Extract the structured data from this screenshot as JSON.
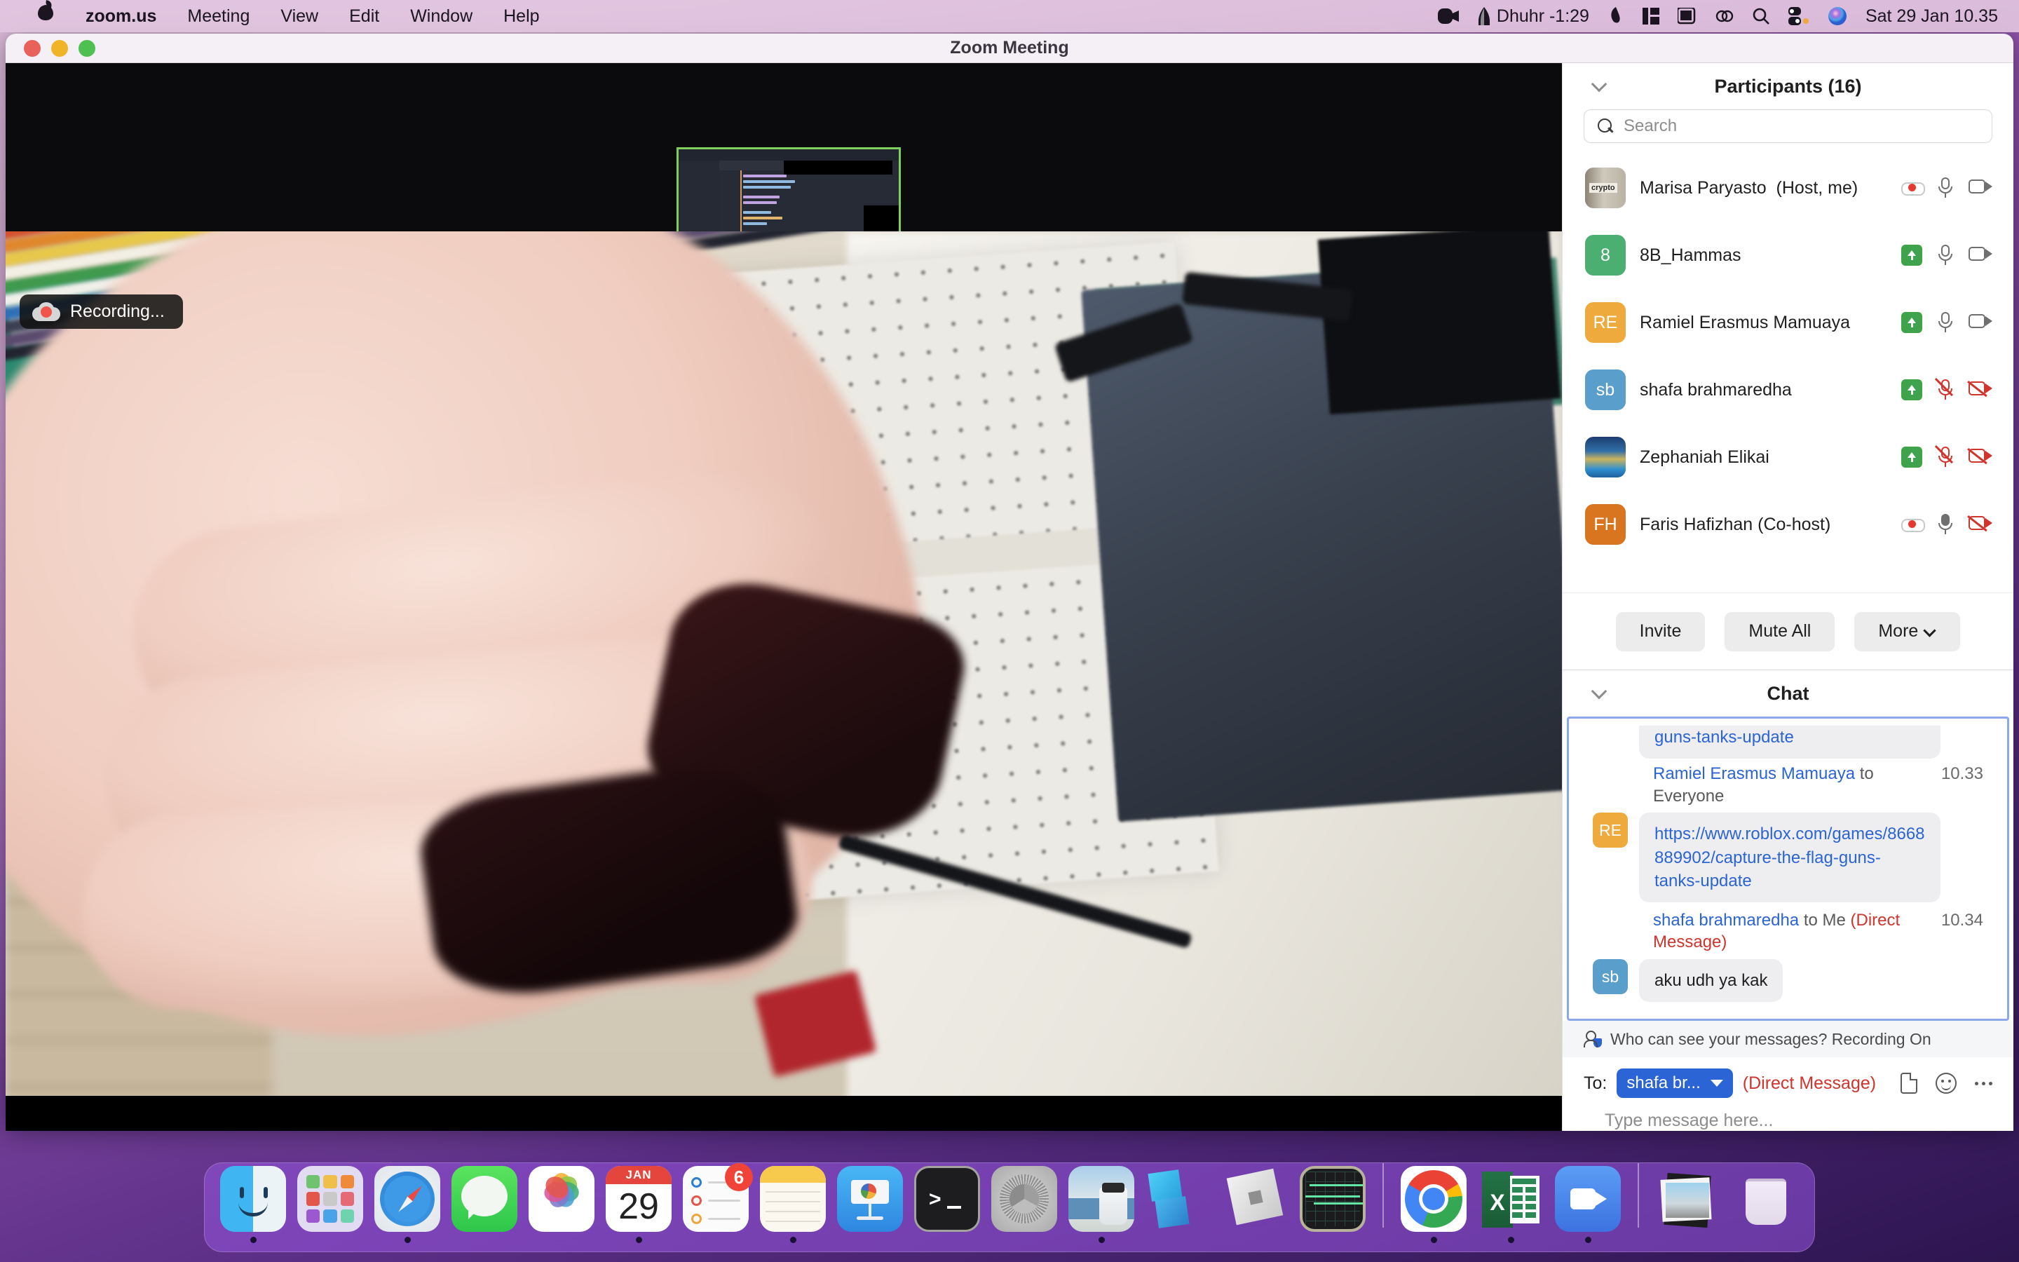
{
  "menubar": {
    "apple_icon": "apple-logo",
    "items": [
      {
        "label": "zoom.us",
        "bold": true
      },
      {
        "label": "Meeting",
        "bold": false
      },
      {
        "label": "View",
        "bold": false
      },
      {
        "label": "Edit",
        "bold": false
      },
      {
        "label": "Window",
        "bold": false
      },
      {
        "label": "Help",
        "bold": false
      }
    ],
    "status": {
      "video_icon": "video-camera-icon",
      "prayer_icon": "mosque-icon",
      "prayer_label": "Dhuhr -1:29",
      "shazam_icon": "shazam-icon",
      "stage_icon": "stage-manager-icon",
      "display_icon": "display-icon",
      "bluetooth_icon": "bluetooth-icon",
      "search_icon": "spotlight-search-icon",
      "controlcenter_icon": "control-center-icon",
      "siri_icon": "siri-icon",
      "clock": "Sat 29 Jan  10.35"
    }
  },
  "window": {
    "title": "Zoom Meeting",
    "traffic_lights": [
      "close",
      "minimize",
      "maximize"
    ]
  },
  "video": {
    "recording_badge": "Recording...",
    "recording_icon": "cloud-record-icon",
    "share_thumbnail_name": "screen-share-thumbnail"
  },
  "participants": {
    "title": "Participants (16)",
    "collapse_icon": "chevron-down-icon",
    "search": {
      "placeholder": "Search",
      "icon": "search-icon"
    },
    "rows": [
      {
        "name": "Marisa Paryasto",
        "role": "(Host, me)",
        "avatar_type": "photo-book",
        "avatar_initials": "",
        "avatar_color": "#8d8374",
        "raise_hand": false,
        "recording": true,
        "mic": "unmuted",
        "camera": "on"
      },
      {
        "name": "8B_Hammas",
        "role": "",
        "avatar_type": "initials",
        "avatar_initials": "8",
        "avatar_color": "#4caf72",
        "raise_hand": true,
        "recording": false,
        "mic": "unmuted",
        "camera": "on"
      },
      {
        "name": "Ramiel Erasmus Mamuaya",
        "role": "",
        "avatar_type": "initials",
        "avatar_initials": "RE",
        "avatar_color": "#eeaa3c",
        "raise_hand": true,
        "recording": false,
        "mic": "unmuted",
        "camera": "on"
      },
      {
        "name": "shafa brahmaredha",
        "role": "",
        "avatar_type": "initials",
        "avatar_initials": "sb",
        "avatar_color": "#5a9ecb",
        "raise_hand": true,
        "recording": false,
        "mic": "muted",
        "camera": "off"
      },
      {
        "name": "Zephaniah Elikai",
        "role": "",
        "avatar_type": "photo-lake",
        "avatar_initials": "",
        "avatar_color": "#2f6ea8",
        "raise_hand": true,
        "recording": false,
        "mic": "muted",
        "camera": "off"
      },
      {
        "name": "Faris Hafizhan (Co-host)",
        "role": "",
        "avatar_type": "initials",
        "avatar_initials": "FH",
        "avatar_color": "#d9741f",
        "raise_hand": false,
        "recording": true,
        "mic": "filled",
        "camera": "off"
      }
    ],
    "footer": {
      "invite": "Invite",
      "mute_all": "Mute All",
      "more": "More",
      "more_icon": "chevron-down-icon"
    }
  },
  "chat": {
    "title": "Chat",
    "collapse_icon": "chevron-down-icon",
    "messages": [
      {
        "continuation": true,
        "avatar_initials": "",
        "avatar_color": "#eeaa3c",
        "sender": "",
        "to": "",
        "time": "",
        "text": "guns-tanks-update",
        "is_link": true,
        "is_dm": false
      },
      {
        "continuation": false,
        "avatar_initials": "RE",
        "avatar_color": "#eeaa3c",
        "sender": "Ramiel Erasmus Mamuaya",
        "to": "to Everyone",
        "time": "10.33",
        "text": "https://www.roblox.com/games/8668889902/capture-the-flag-guns-tanks-update",
        "is_link": true,
        "is_dm": false
      },
      {
        "continuation": false,
        "avatar_initials": "sb",
        "avatar_color": "#5a9ecb",
        "sender": "shafa brahmaredha",
        "to": "to Me ",
        "dm_tag": "(Direct Message)",
        "time": "10.34",
        "text": "aku udh ya kak",
        "is_link": false,
        "is_dm": true
      }
    ],
    "notice": "Who can see your messages? Recording On",
    "notice_icon": "people-privacy-icon",
    "compose": {
      "to_label": "To:",
      "to_chip": "shafa br...",
      "to_chip_icon": "chevron-down-icon",
      "dm_tag": "(Direct Message)",
      "file_icon": "file-icon",
      "emoji_icon": "emoji-icon",
      "more_icon": "more-dots-icon",
      "placeholder": "Type message here..."
    }
  },
  "dock": {
    "items": [
      {
        "name": "finder",
        "label": "Finder",
        "running": true
      },
      {
        "name": "launchpad",
        "label": "Launchpad",
        "running": false
      },
      {
        "name": "safari",
        "label": "Safari",
        "running": true
      },
      {
        "name": "messages",
        "label": "Messages",
        "running": false
      },
      {
        "name": "photos",
        "label": "Photos",
        "running": false
      },
      {
        "name": "calendar",
        "label": "Calendar",
        "running": true,
        "month": "JAN",
        "day": "29"
      },
      {
        "name": "reminders",
        "label": "Reminders",
        "running": false,
        "badge": "6"
      },
      {
        "name": "notes",
        "label": "Notes",
        "running": true
      },
      {
        "name": "keynote",
        "label": "Keynote",
        "running": false
      },
      {
        "name": "terminal",
        "label": "Terminal",
        "running": false
      },
      {
        "name": "system-preferences",
        "label": "System Preferences",
        "running": false
      },
      {
        "name": "preview",
        "label": "Preview",
        "running": true
      },
      {
        "name": "roblox-studio",
        "label": "Roblox Studio",
        "running": false
      },
      {
        "name": "roblox",
        "label": "Roblox",
        "running": false
      },
      {
        "name": "activity-monitor",
        "label": "Activity Monitor",
        "running": false
      },
      {
        "name": "chrome",
        "label": "Google Chrome",
        "running": true
      },
      {
        "name": "excel",
        "label": "Microsoft Excel",
        "running": true
      },
      {
        "name": "zoom",
        "label": "Zoom",
        "running": true
      },
      {
        "name": "screenshots-stack",
        "label": "Screenshots",
        "running": false
      },
      {
        "name": "trash",
        "label": "Trash",
        "running": false
      }
    ]
  },
  "colors": {
    "accent_blue": "#2b64d4",
    "danger_red": "#d0342c",
    "raise_green": "#3fa34d",
    "chat_border": "#8ba8e8"
  }
}
